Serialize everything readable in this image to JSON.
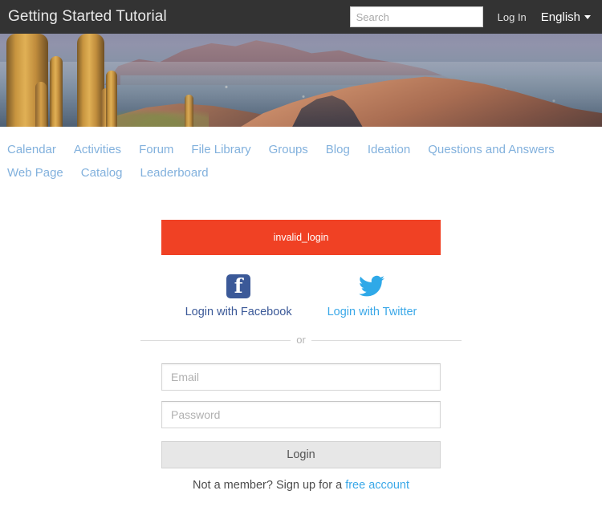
{
  "header": {
    "site_title": "Getting Started Tutorial",
    "search": {
      "placeholder": "Search",
      "value": ""
    },
    "login_link": "Log In",
    "language": "English",
    "bar_color": "#333333"
  },
  "hero": {
    "alt": "Desert sunset landscape with saguaro cacti and mountain ridge"
  },
  "nav": {
    "items": [
      {
        "label": "Calendar"
      },
      {
        "label": "Activities"
      },
      {
        "label": "Forum"
      },
      {
        "label": "File Library"
      },
      {
        "label": "Groups"
      },
      {
        "label": "Blog"
      },
      {
        "label": "Ideation"
      },
      {
        "label": "Questions and Answers"
      },
      {
        "label": "Web Page"
      },
      {
        "label": "Catalog"
      },
      {
        "label": "Leaderboard"
      }
    ],
    "link_color": "#82b1dd"
  },
  "main": {
    "alert": {
      "message": "invalid_login",
      "background": "#f04124",
      "text_color": "#ffffff"
    },
    "social": {
      "facebook": {
        "label": "Login with Facebook",
        "icon": "facebook-icon",
        "color": "#3b5998"
      },
      "twitter": {
        "label": "Login with Twitter",
        "icon": "twitter-icon",
        "color": "#3aa8e8"
      }
    },
    "divider_text": "or",
    "form": {
      "email": {
        "placeholder": "Email",
        "value": ""
      },
      "password": {
        "placeholder": "Password",
        "value": ""
      },
      "submit_label": "Login"
    },
    "signup": {
      "prompt": "Not a member? Sign up for a ",
      "link_label": "free account"
    }
  }
}
